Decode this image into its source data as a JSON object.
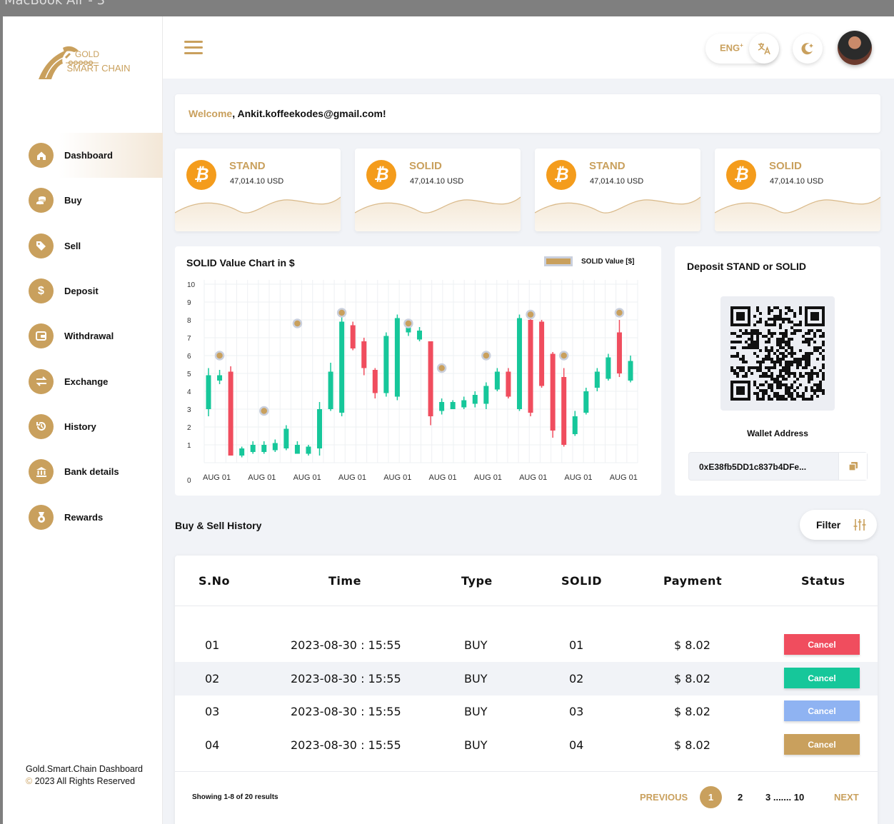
{
  "window": {
    "title": "MacBook Air - 3"
  },
  "brand": {
    "line1": "GOLD",
    "line2": "SMART CHAIN"
  },
  "sidebar": {
    "items": [
      {
        "label": "Dashboard",
        "icon": "home-icon"
      },
      {
        "label": "Buy",
        "icon": "coins-icon"
      },
      {
        "label": "Sell",
        "icon": "tag-icon"
      },
      {
        "label": "Deposit",
        "icon": "dollar-icon"
      },
      {
        "label": "Withdrawal",
        "icon": "wallet-icon"
      },
      {
        "label": "Exchange",
        "icon": "exchange-icon"
      },
      {
        "label": "History",
        "icon": "history-icon"
      },
      {
        "label": "Bank details",
        "icon": "bank-icon"
      },
      {
        "label": "Rewards",
        "icon": "medal-icon"
      }
    ],
    "footer_line1": "Gold.Smart.Chain Dashboard",
    "footer_copy": "©",
    "footer_line2": " 2023 All Rights Reserved"
  },
  "header": {
    "lang": "ENG",
    "lang_sup": "+"
  },
  "welcome": {
    "greeting": "Welcome",
    "user": ", Ankit.koffeekodes@gmail.com!"
  },
  "cards": [
    {
      "name": "STAND",
      "value": "47,014.10 USD"
    },
    {
      "name": "SOLID",
      "value": "47,014.10 USD"
    },
    {
      "name": "STAND",
      "value": "47,014.10 USD"
    },
    {
      "name": "SOLID",
      "value": "47,014.10 USD"
    }
  ],
  "colors": {
    "gold": "#c9a05d",
    "up": "#16c79a",
    "down": "#f04d5e",
    "blue": "#8fb3f2"
  },
  "chart_data": {
    "type": "candlestick",
    "title": "SOLID Value Chart in $",
    "legend": "SOLID Value [$]",
    "ylim": [
      0,
      10
    ],
    "yticks": [
      0,
      1,
      2,
      3,
      4,
      5,
      6,
      7,
      8,
      9,
      10
    ],
    "xticks": [
      "AUG 01",
      "AUG 01",
      "AUG 01",
      "AUG 01",
      "AUG 01",
      "AUG 01",
      "AUG 01",
      "AUG 01",
      "AUG 01",
      "AUG 01"
    ],
    "candles": [
      {
        "o": 3.0,
        "c": 4.9,
        "h": 5.3,
        "l": 2.6
      },
      {
        "o": 4.6,
        "c": 4.9,
        "h": 5.2,
        "l": 4.4
      },
      {
        "o": 5.1,
        "c": 0.4,
        "h": 5.4,
        "l": 0.4
      },
      {
        "o": 0.4,
        "c": 0.8,
        "h": 0.9,
        "l": 0.3
      },
      {
        "o": 0.6,
        "c": 1.0,
        "h": 1.2,
        "l": 0.5
      },
      {
        "o": 0.6,
        "c": 1.0,
        "h": 1.2,
        "l": 0.5
      },
      {
        "o": 0.7,
        "c": 1.1,
        "h": 1.3,
        "l": 0.6
      },
      {
        "o": 0.8,
        "c": 1.9,
        "h": 2.1,
        "l": 0.7
      },
      {
        "o": 0.5,
        "c": 1.0,
        "h": 1.2,
        "l": 0.5
      },
      {
        "o": 0.5,
        "c": 0.9,
        "h": 1.0,
        "l": 0.4
      },
      {
        "o": 0.8,
        "c": 3.0,
        "h": 3.4,
        "l": 0.4
      },
      {
        "o": 3.0,
        "c": 5.1,
        "h": 5.6,
        "l": 2.9
      },
      {
        "o": 2.8,
        "c": 7.9,
        "h": 8.2,
        "l": 2.6
      },
      {
        "o": 7.7,
        "c": 6.4,
        "h": 7.9,
        "l": 6.3
      },
      {
        "o": 6.8,
        "c": 5.3,
        "h": 7.0,
        "l": 4.9
      },
      {
        "o": 5.2,
        "c": 3.9,
        "h": 5.3,
        "l": 3.6
      },
      {
        "o": 3.9,
        "c": 7.1,
        "h": 7.3,
        "l": 3.7
      },
      {
        "o": 3.7,
        "c": 8.1,
        "h": 8.3,
        "l": 3.5
      },
      {
        "o": 7.3,
        "c": 7.8,
        "h": 7.9,
        "l": 7.1
      },
      {
        "o": 6.9,
        "c": 7.4,
        "h": 7.6,
        "l": 6.8
      },
      {
        "o": 6.8,
        "c": 2.6,
        "h": 6.8,
        "l": 2.1
      },
      {
        "o": 2.9,
        "c": 3.4,
        "h": 3.6,
        "l": 2.7
      },
      {
        "o": 3.0,
        "c": 3.4,
        "h": 3.5,
        "l": 3.0
      },
      {
        "o": 3.1,
        "c": 3.5,
        "h": 3.7,
        "l": 3.0
      },
      {
        "o": 3.3,
        "c": 3.8,
        "h": 4.0,
        "l": 3.1
      },
      {
        "o": 3.3,
        "c": 4.3,
        "h": 4.5,
        "l": 3.0
      },
      {
        "o": 4.1,
        "c": 5.1,
        "h": 5.3,
        "l": 4.0
      },
      {
        "o": 5.1,
        "c": 3.7,
        "h": 5.3,
        "l": 3.6
      },
      {
        "o": 3.0,
        "c": 8.1,
        "h": 8.3,
        "l": 2.9
      },
      {
        "o": 8.0,
        "c": 2.8,
        "h": 8.2,
        "l": 2.6
      },
      {
        "o": 7.9,
        "c": 4.3,
        "h": 8.0,
        "l": 4.2
      },
      {
        "o": 6.1,
        "c": 1.8,
        "h": 6.2,
        "l": 1.4
      },
      {
        "o": 4.8,
        "c": 1.0,
        "h": 5.3,
        "l": 0.9
      },
      {
        "o": 1.6,
        "c": 2.6,
        "h": 2.9,
        "l": 1.5
      },
      {
        "o": 2.8,
        "c": 4.0,
        "h": 4.2,
        "l": 2.7
      },
      {
        "o": 4.2,
        "c": 5.1,
        "h": 5.3,
        "l": 4.0
      },
      {
        "o": 4.7,
        "c": 5.9,
        "h": 6.1,
        "l": 4.6
      },
      {
        "o": 7.3,
        "c": 5.0,
        "h": 8.0,
        "l": 4.8
      },
      {
        "o": 4.6,
        "c": 5.7,
        "h": 6.0,
        "l": 4.5
      }
    ],
    "markers": [
      {
        "i": 1,
        "v": 6.0
      },
      {
        "i": 5,
        "v": 2.9
      },
      {
        "i": 8,
        "v": 7.8
      },
      {
        "i": 12,
        "v": 8.4
      },
      {
        "i": 18,
        "v": 7.8
      },
      {
        "i": 21,
        "v": 5.3
      },
      {
        "i": 25,
        "v": 6.0
      },
      {
        "i": 29,
        "v": 8.3
      },
      {
        "i": 32,
        "v": 6.0
      },
      {
        "i": 37,
        "v": 8.4
      }
    ]
  },
  "deposit": {
    "title": "Deposit STAND or SOLID",
    "wallet_label": "Wallet Address",
    "wallet_address": "0xE38fb5DD1c837b4DFe..."
  },
  "history": {
    "title": "Buy & Sell History",
    "filter_label": "Filter",
    "columns": [
      "S.No",
      "Time",
      "Type",
      "SOLID",
      "Payment",
      "Status"
    ],
    "rows": [
      {
        "sno": "01",
        "time": "2023-08-30 : 15:55",
        "type": "BUY",
        "solid": "01",
        "payment": "$ 8.02",
        "status": "Cancel",
        "status_color": "#f04d5e"
      },
      {
        "sno": "02",
        "time": "2023-08-30 : 15:55",
        "type": "BUY",
        "solid": "02",
        "payment": "$ 8.02",
        "status": "Cancel",
        "status_color": "#16c79a"
      },
      {
        "sno": "03",
        "time": "2023-08-30 : 15:55",
        "type": "BUY",
        "solid": "03",
        "payment": "$ 8.02",
        "status": "Cancel",
        "status_color": "#8fb3f2"
      },
      {
        "sno": "04",
        "time": "2023-08-30 : 15:55",
        "type": "BUY",
        "solid": "04",
        "payment": "$ 8.02",
        "status": "Cancel",
        "status_color": "#c9a05d"
      }
    ],
    "showing": "Showing 1-8 of 20 results",
    "pagination": {
      "prev": "PREVIOUS",
      "current": "1",
      "p2": "2",
      "p3": "3 ....... 10",
      "next": "NEXT"
    }
  }
}
